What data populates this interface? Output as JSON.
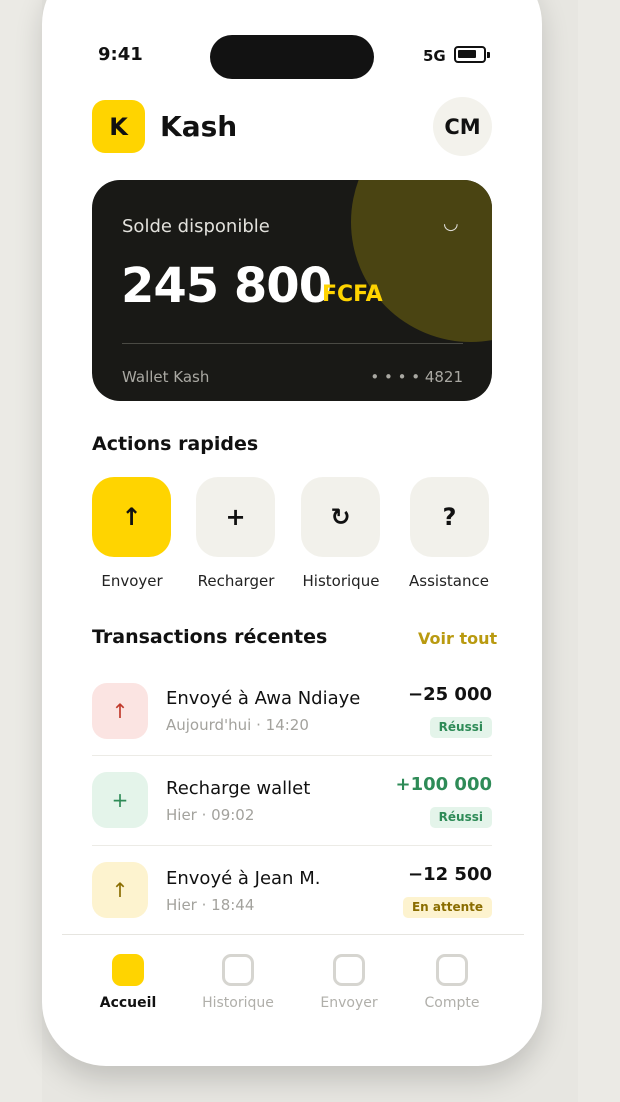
{
  "status_bar": {
    "time": "9:41",
    "network": "5G"
  },
  "header": {
    "logo_letter": "K",
    "app_name": "Kash",
    "avatar_initials": "CM"
  },
  "balance_card": {
    "label": "Solde disponible",
    "chevron": "◡",
    "amount": "245 800",
    "currency": "FCFA",
    "wallet_name": "Wallet Kash",
    "card_number": "• • • • 4821"
  },
  "quick_actions": {
    "title": "Actions rapides",
    "items": [
      {
        "label": "Envoyer",
        "icon": "↑",
        "icon_name": "arrow-up-icon"
      },
      {
        "label": "Recharger",
        "icon": "+",
        "icon_name": "plus-icon"
      },
      {
        "label": "Historique",
        "icon": "↻",
        "icon_name": "refresh-icon"
      },
      {
        "label": "Assistance",
        "icon": "?",
        "icon_name": "question-icon"
      }
    ]
  },
  "transactions": {
    "title": "Transactions récentes",
    "see_all": "Voir tout",
    "items": [
      {
        "title": "Envoyé à Awa Ndiaye",
        "subtitle": "Aujourd'hui · 14:20",
        "amount": "−25 000",
        "status": "Réussi",
        "icon": "↑",
        "icon_name": "arrow-up-icon"
      },
      {
        "title": "Recharge wallet",
        "subtitle": "Hier · 09:02",
        "amount": "+100 000",
        "status": "Réussi",
        "icon": "+",
        "icon_name": "plus-icon"
      },
      {
        "title": "Envoyé à Jean M.",
        "subtitle": "Hier · 18:44",
        "amount": "−12 500",
        "status": "En attente",
        "icon": "↑",
        "icon_name": "arrow-up-icon"
      }
    ]
  },
  "bottom_nav": {
    "items": [
      {
        "label": "Accueil",
        "active": true
      },
      {
        "label": "Historique",
        "active": false
      },
      {
        "label": "Envoyer",
        "active": false
      },
      {
        "label": "Compte",
        "active": false
      }
    ]
  },
  "colors": {
    "accent": "#ffd400",
    "card_bg": "#191916",
    "success": "#2e8b57",
    "warning": "#8a6d00",
    "danger": "#c0392b"
  }
}
